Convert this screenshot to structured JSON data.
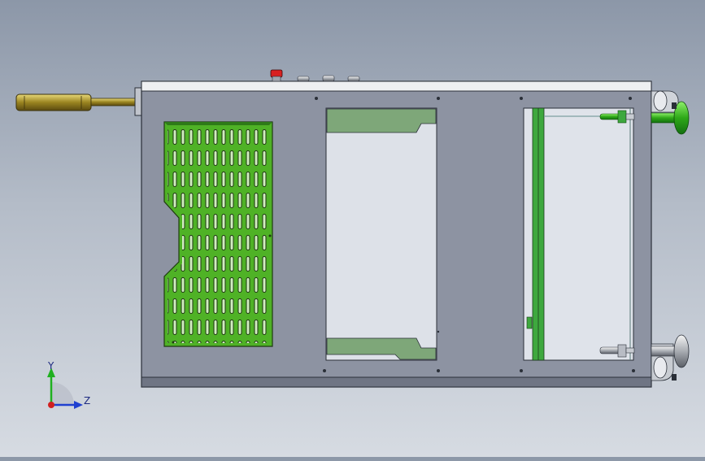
{
  "viewport": {
    "background_top": "#8c97a8",
    "background_bottom": "#d6dbe2"
  },
  "model": {
    "body_color": "#8d93a2",
    "panel_green": "#4fb226",
    "light_green": "#7ea779",
    "edge_color": "#2a2f38",
    "brass_color": "#b8a23a",
    "emergency_stop_color": "#d82020"
  },
  "triad": {
    "y_label": "Y",
    "z_label": "Z",
    "y_color": "#20b020",
    "z_color": "#2040d0",
    "x_color": "#d02020"
  }
}
